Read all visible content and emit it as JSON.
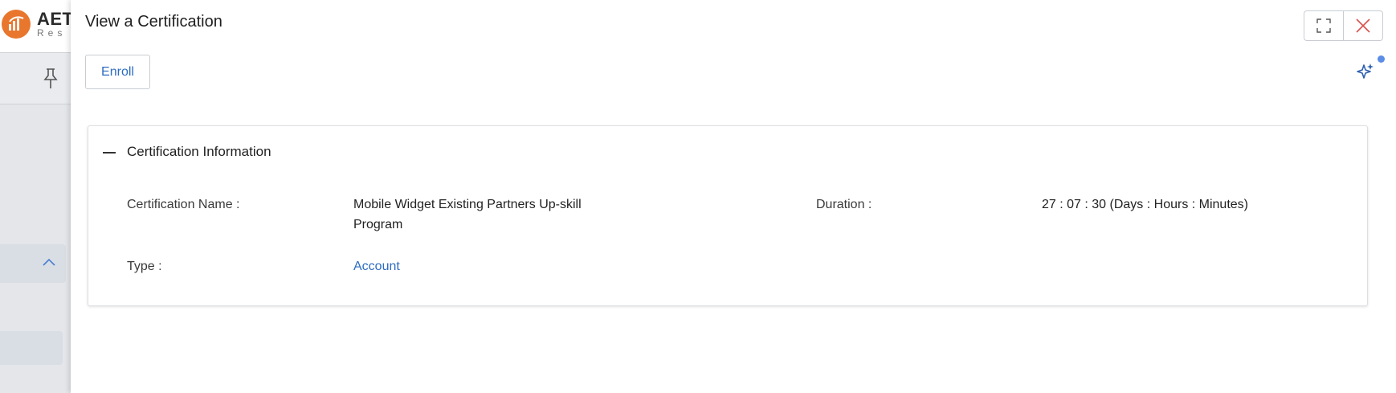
{
  "background": {
    "logo_text": "AET",
    "logo_sub": "Res"
  },
  "drawer": {
    "title": "View a Certification",
    "enroll_label": "Enroll",
    "icons": {
      "expand": "expand-icon",
      "close": "close-icon",
      "assistant": "sparkle-icon"
    }
  },
  "card": {
    "title": "Certification Information",
    "fields": {
      "certification_name_label": "Certification Name :",
      "certification_name_value": "Mobile Widget Existing Partners Up-skill Program",
      "duration_label": "Duration :",
      "duration_value": "27 : 07 : 30",
      "duration_unit": "(Days : Hours : Minutes)",
      "type_label": "Type :",
      "type_value": "Account"
    }
  },
  "colors": {
    "accent": "#2d6cc0",
    "close": "#d9534f",
    "logo": "#e8762d",
    "notification": "#5b8de6"
  }
}
